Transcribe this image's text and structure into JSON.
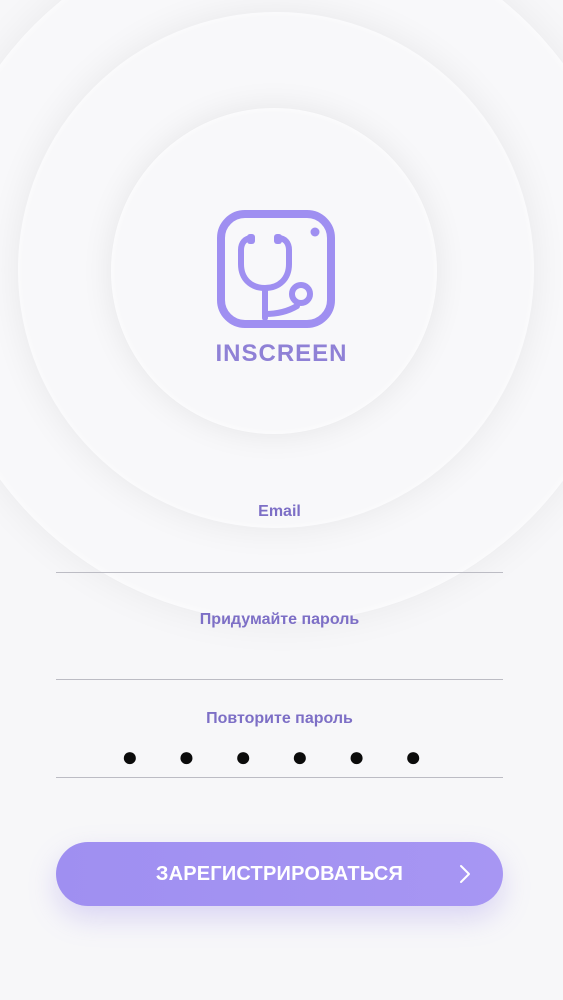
{
  "app": {
    "brand_name": "INSCREEN"
  },
  "form": {
    "email_label": "Email",
    "password_label": "Придумайте пароль",
    "repeat_password_label": "Повторите пароль",
    "repeat_password_value": "● ● ● ● ● ●"
  },
  "actions": {
    "register_label": "ЗАРЕГИСТРИРОВАТЬСЯ"
  },
  "icons": {
    "logo": "stethoscope-icon",
    "next": "chevron-right-icon"
  },
  "colors": {
    "accent": "#9f8ff1",
    "label": "#7d6fc6",
    "background": "#f7f7f9",
    "divider": "#bcbcc4",
    "dots": "#0b0b0b"
  }
}
